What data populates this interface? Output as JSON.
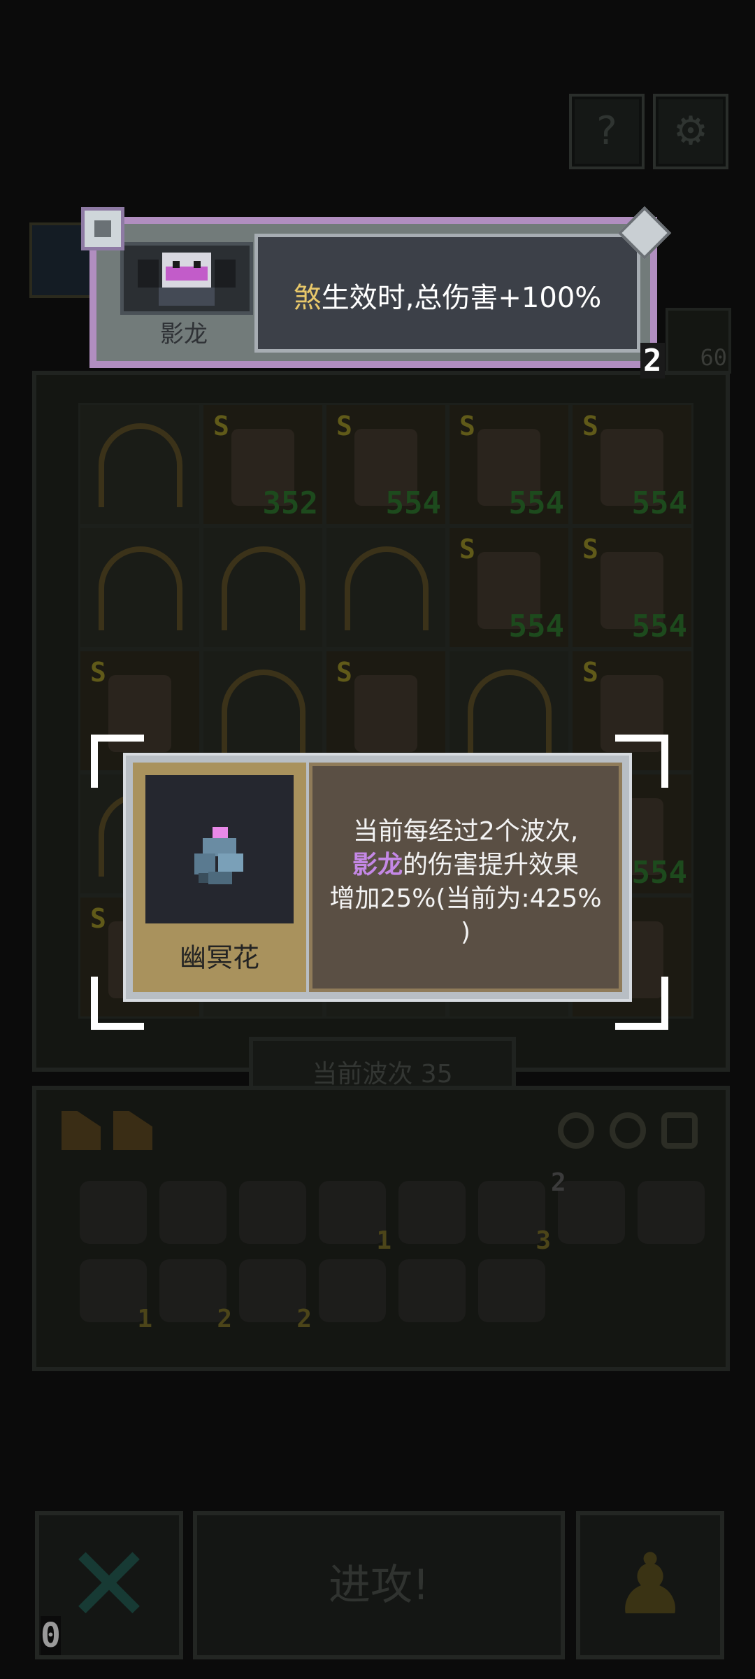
{
  "hero_tooltip": {
    "name": "影龙",
    "desc_highlight": "煞",
    "desc_rest": "生效时,总伤害+100%",
    "badge": "2"
  },
  "item_tooltip": {
    "name": "幽冥花",
    "line1": "当前每经过2个波次,",
    "highlight": "影龙",
    "line2": "的伤害提升效果",
    "line3": "增加25%(当前为:425%",
    "line4": ")"
  },
  "board": {
    "cells": [
      {
        "s": "",
        "lvl": "",
        "type": "arch"
      },
      {
        "s": "S",
        "lvl": "352",
        "type": "hero"
      },
      {
        "s": "S",
        "lvl": "554",
        "type": "hero"
      },
      {
        "s": "S",
        "lvl": "554",
        "type": "hero"
      },
      {
        "s": "S",
        "lvl": "554",
        "type": "hero"
      },
      {
        "s": "",
        "lvl": "",
        "type": "arch"
      },
      {
        "s": "",
        "lvl": "",
        "type": "arch"
      },
      {
        "s": "",
        "lvl": "",
        "type": "arch"
      },
      {
        "s": "S",
        "lvl": "554",
        "type": "hero"
      },
      {
        "s": "S",
        "lvl": "554",
        "type": "hero"
      },
      {
        "s": "S",
        "lvl": "",
        "type": "hero"
      },
      {
        "s": "",
        "lvl": "",
        "type": "arch"
      },
      {
        "s": "S",
        "lvl": "",
        "type": "hero"
      },
      {
        "s": "",
        "lvl": "",
        "type": "arch"
      },
      {
        "s": "S",
        "lvl": "",
        "type": "hero"
      },
      {
        "s": "",
        "lvl": "",
        "type": "arch"
      },
      {
        "s": "",
        "lvl": "",
        "type": "arch"
      },
      {
        "s": "",
        "lvl": "",
        "type": "arch"
      },
      {
        "s": "",
        "lvl": "",
        "type": "arch"
      },
      {
        "s": "",
        "lvl": "554",
        "type": "hero"
      },
      {
        "s": "S",
        "lvl": "",
        "type": "hero"
      },
      {
        "s": "",
        "lvl": "",
        "type": "arch"
      },
      {
        "s": "",
        "lvl": "",
        "type": "arch"
      },
      {
        "s": "",
        "lvl": "",
        "type": "arch"
      },
      {
        "s": "",
        "lvl": "",
        "type": "hero"
      }
    ]
  },
  "side_badge": "60",
  "wave_label": "当前波次 35",
  "inventory_counts": {
    "i4": "1",
    "i6": "3",
    "i7": "2",
    "i9": "1",
    "i10": "2",
    "i11": "2"
  },
  "bottom": {
    "attack_label": "进攻!",
    "counter": "0"
  }
}
